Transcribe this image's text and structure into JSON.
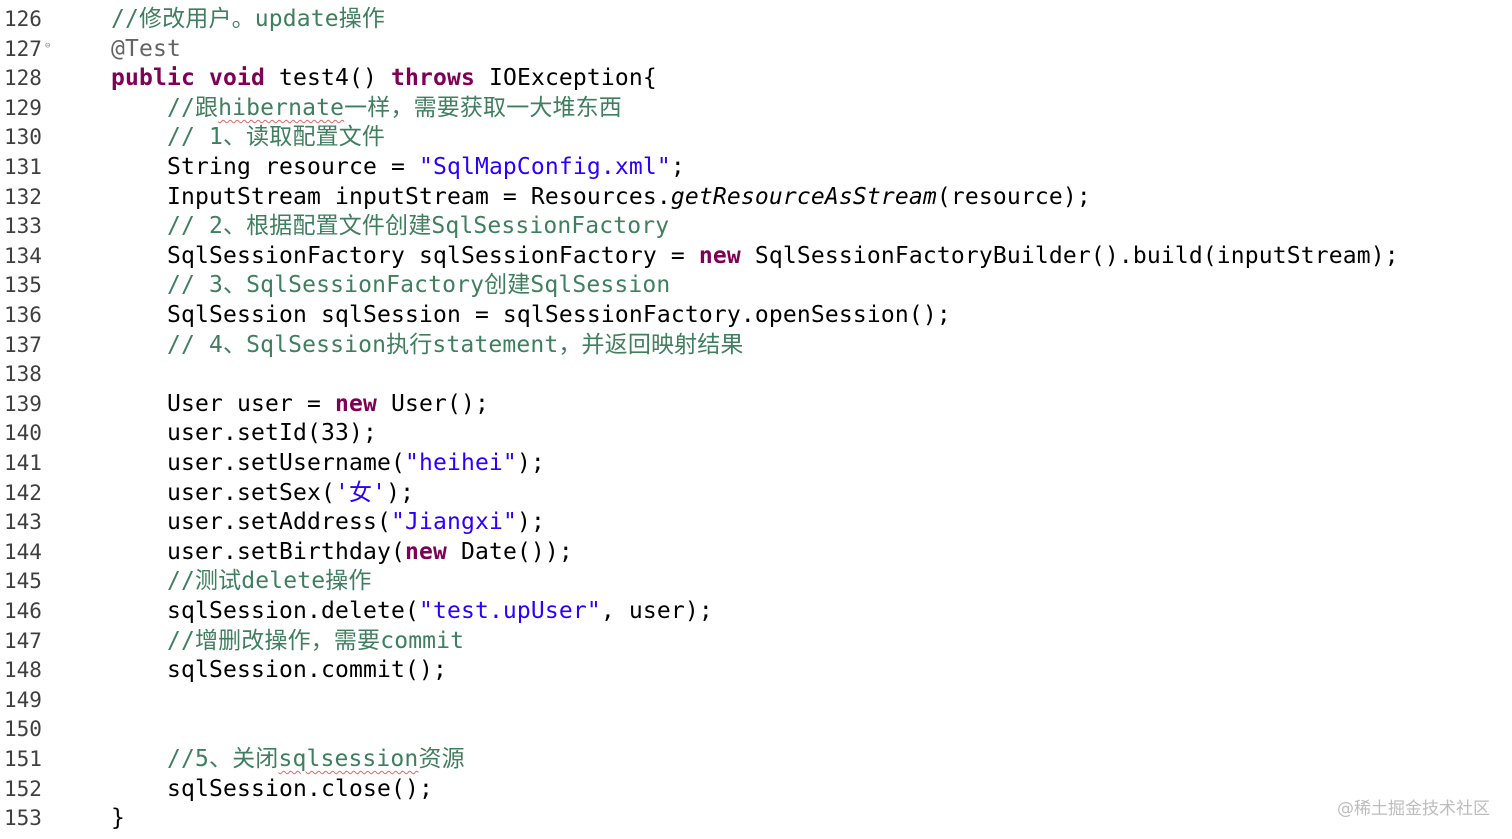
{
  "editor": {
    "lines": [
      {
        "no": "126",
        "indent": 1,
        "segs": [
          {
            "t": "//修改用户。update操作",
            "c": "cmt"
          }
        ]
      },
      {
        "no": "127",
        "indent": 1,
        "fold": "⊖",
        "segs": [
          {
            "t": "@Test",
            "c": "ann"
          }
        ]
      },
      {
        "no": "128",
        "indent": 1,
        "segs": [
          {
            "t": "public",
            "c": "kw"
          },
          {
            "t": " "
          },
          {
            "t": "void",
            "c": "kw"
          },
          {
            "t": " test4() "
          },
          {
            "t": "throws",
            "c": "kw"
          },
          {
            "t": " IOException{"
          }
        ]
      },
      {
        "no": "129",
        "indent": 2,
        "segs": [
          {
            "t": "//跟",
            "c": "cmt"
          },
          {
            "t": "hibernate",
            "c": "cmt squig"
          },
          {
            "t": "一样，需要获取一大堆东西",
            "c": "cmt"
          }
        ]
      },
      {
        "no": "130",
        "indent": 2,
        "segs": [
          {
            "t": "// 1、读取配置文件",
            "c": "cmt"
          }
        ]
      },
      {
        "no": "131",
        "indent": 2,
        "segs": [
          {
            "t": "String resource = "
          },
          {
            "t": "\"SqlMapConfig.xml\"",
            "c": "str"
          },
          {
            "t": ";"
          }
        ]
      },
      {
        "no": "132",
        "indent": 2,
        "segs": [
          {
            "t": "InputStream inputStream = Resources."
          },
          {
            "t": "getResourceAsStream",
            "c": "it"
          },
          {
            "t": "(resource);"
          }
        ]
      },
      {
        "no": "133",
        "indent": 2,
        "segs": [
          {
            "t": "// 2、根据配置文件创建SqlSessionFactory",
            "c": "cmt"
          }
        ]
      },
      {
        "no": "134",
        "indent": 2,
        "segs": [
          {
            "t": "SqlSessionFactory sqlSessionFactory = "
          },
          {
            "t": "new",
            "c": "kw"
          },
          {
            "t": " SqlSessionFactoryBuilder().build(inputStream);"
          }
        ]
      },
      {
        "no": "135",
        "indent": 2,
        "segs": [
          {
            "t": "// 3、SqlSessionFactory创建SqlSession",
            "c": "cmt"
          }
        ]
      },
      {
        "no": "136",
        "indent": 2,
        "segs": [
          {
            "t": "SqlSession sqlSession = sqlSessionFactory.openSession();"
          }
        ]
      },
      {
        "no": "137",
        "indent": 2,
        "segs": [
          {
            "t": "// 4、SqlSession执行statement，并返回映射结果",
            "c": "cmt"
          }
        ]
      },
      {
        "no": "138",
        "indent": 2,
        "segs": []
      },
      {
        "no": "139",
        "indent": 2,
        "segs": [
          {
            "t": "User user = "
          },
          {
            "t": "new",
            "c": "kw"
          },
          {
            "t": " User();"
          }
        ]
      },
      {
        "no": "140",
        "indent": 2,
        "segs": [
          {
            "t": "user.setId(33);"
          }
        ]
      },
      {
        "no": "141",
        "indent": 2,
        "segs": [
          {
            "t": "user.setUsername("
          },
          {
            "t": "\"heihei\"",
            "c": "str"
          },
          {
            "t": ");"
          }
        ]
      },
      {
        "no": "142",
        "indent": 2,
        "segs": [
          {
            "t": "user.setSex("
          },
          {
            "t": "'女'",
            "c": "str"
          },
          {
            "t": ");"
          }
        ]
      },
      {
        "no": "143",
        "indent": 2,
        "segs": [
          {
            "t": "user.setAddress("
          },
          {
            "t": "\"Jiangxi\"",
            "c": "str"
          },
          {
            "t": ");"
          }
        ]
      },
      {
        "no": "144",
        "indent": 2,
        "segs": [
          {
            "t": "user.setBirthday("
          },
          {
            "t": "new",
            "c": "kw"
          },
          {
            "t": " Date());"
          }
        ]
      },
      {
        "no": "145",
        "indent": 2,
        "segs": [
          {
            "t": "//测试delete操作",
            "c": "cmt"
          }
        ]
      },
      {
        "no": "146",
        "indent": 2,
        "segs": [
          {
            "t": "sqlSession.delete("
          },
          {
            "t": "\"test.upUser\"",
            "c": "str"
          },
          {
            "t": ", user);"
          }
        ]
      },
      {
        "no": "147",
        "indent": 2,
        "segs": [
          {
            "t": "//增删改操作，需要commit",
            "c": "cmt"
          }
        ]
      },
      {
        "no": "148",
        "indent": 2,
        "segs": [
          {
            "t": "sqlSession.commit();"
          }
        ]
      },
      {
        "no": "149",
        "indent": 2,
        "segs": []
      },
      {
        "no": "150",
        "indent": 2,
        "segs": []
      },
      {
        "no": "151",
        "indent": 2,
        "segs": [
          {
            "t": "//5、关闭",
            "c": "cmt"
          },
          {
            "t": "sqlsession",
            "c": "cmt squig"
          },
          {
            "t": "资源",
            "c": "cmt"
          }
        ]
      },
      {
        "no": "152",
        "indent": 2,
        "segs": [
          {
            "t": "sqlSession.close();"
          }
        ]
      },
      {
        "no": "153",
        "indent": 1,
        "segs": [
          {
            "t": "}"
          }
        ]
      }
    ]
  },
  "watermark": "@稀土掘金技术社区",
  "colors": {
    "keyword": "#7f0055",
    "string": "#2a00ff",
    "comment": "#3f7f5f",
    "annotation": "#646464",
    "line_number": "#3f3f3f"
  }
}
